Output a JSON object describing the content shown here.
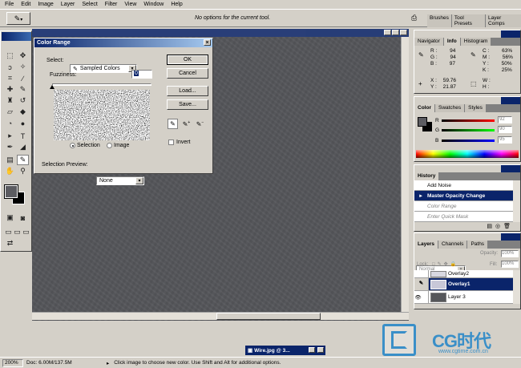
{
  "menu": [
    "File",
    "Edit",
    "Image",
    "Layer",
    "Select",
    "Filter",
    "View",
    "Window",
    "Help"
  ],
  "options_bar": {
    "message": "No options for the current tool."
  },
  "palette_well": {
    "tabs": [
      "Brushes",
      "Tool Presets",
      "Layer Comps"
    ]
  },
  "color_range": {
    "title": "Color Range",
    "select_label": "Select:",
    "select_value": "Sampled Colors",
    "fuzziness_label": "Fuzziness:",
    "fuzziness_value": "0",
    "radio_selection": "Selection",
    "radio_image": "Image",
    "preview_label": "Selection Preview:",
    "preview_value": "None",
    "ok": "OK",
    "cancel": "Cancel",
    "load": "Load...",
    "save": "Save...",
    "invert": "Invert"
  },
  "info_panel": {
    "tabs": [
      "Navigator",
      "Info",
      "Histogram"
    ],
    "r_label": "R :",
    "r": "94",
    "g_label": "G :",
    "g": "94",
    "b_label": "B :",
    "b": "97",
    "c_label": "C :",
    "c": "63%",
    "m_label": "M :",
    "m": "56%",
    "y_label": "Y :",
    "y": "50%",
    "k_label": "K :",
    "k": "25%",
    "x_label": "X :",
    "x": "59.76",
    "y2_label": "Y :",
    "y2": "21.87",
    "w_label": "W :",
    "h_label": "H :"
  },
  "color_panel": {
    "tabs": [
      "Color",
      "Swatches",
      "Styles"
    ],
    "r_label": "R",
    "r": "92",
    "g_label": "G",
    "g": "90",
    "b_label": "B",
    "b": "95"
  },
  "history_panel": {
    "tabs": [
      "History"
    ],
    "items": [
      "Add Noise",
      "Master Opacity Change",
      "Color Range",
      "Enter Quick Mask"
    ]
  },
  "layers_panel": {
    "tabs": [
      "Layers",
      "Channels",
      "Paths"
    ],
    "blend_mode": "Normal",
    "opacity_label": "Opacity:",
    "opacity": "100%",
    "lock_label": "Lock:",
    "fill_label": "Fill:",
    "fill": "100%",
    "layers": [
      "Overlay2",
      "Overlay1",
      "Layer 3"
    ]
  },
  "minimized_doc": {
    "title": "Wire.jpg @ 3..."
  },
  "status": {
    "zoom": "200%",
    "doc": "Doc: 6.00M/137.5M",
    "message": "Click image to choose new color.  Use Shift and Alt for additional options."
  },
  "watermark": {
    "brand": "CG时代",
    "url": "www.cgtime.com.cn"
  },
  "colors": {
    "title_blue": "#0a246a",
    "canvas": "#55565a",
    "panel": "#d4d0c8"
  }
}
